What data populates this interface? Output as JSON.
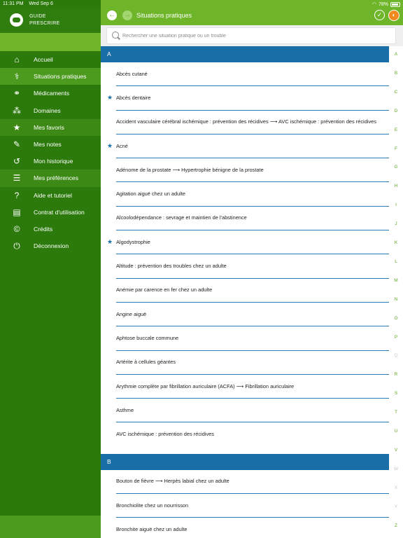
{
  "status": {
    "time": "11:31 PM",
    "date": "Wed Sep 6",
    "battery": "78%"
  },
  "brand": {
    "line1": "GUIDE",
    "line2": "PRESCRIRE"
  },
  "sidebar": {
    "items": [
      {
        "label": "Accueil",
        "icon": "home-icon",
        "glyph": "⌂"
      },
      {
        "label": "Situations pratiques",
        "icon": "situations-icon",
        "glyph": "⚕"
      },
      {
        "label": "Médicaments",
        "icon": "pills-icon",
        "glyph": "⚭"
      },
      {
        "label": "Domaines",
        "icon": "domains-icon",
        "glyph": "⁂"
      },
      {
        "label": "Mes favoris",
        "icon": "star-icon",
        "glyph": "★"
      },
      {
        "label": "Mes notes",
        "icon": "pencil-icon",
        "glyph": "✎"
      },
      {
        "label": "Mon historique",
        "icon": "history-icon",
        "glyph": "↺"
      },
      {
        "label": "Mes préférences",
        "icon": "sliders-icon",
        "glyph": "☰"
      },
      {
        "label": "Aide et tutoriel",
        "icon": "help-icon",
        "glyph": "?"
      },
      {
        "label": "Contrat d'utilisation",
        "icon": "document-icon",
        "glyph": "▤"
      },
      {
        "label": "Crédits",
        "icon": "credits-icon",
        "glyph": "©"
      },
      {
        "label": "Déconnexion",
        "icon": "power-icon",
        "glyph": "⏻"
      }
    ]
  },
  "header": {
    "title": "Situations pratiques"
  },
  "search": {
    "placeholder": "Rechercher une situation pratique ou un trouble"
  },
  "sections": [
    {
      "letter": "A",
      "rows": [
        {
          "label": "Abcès cutané",
          "starred": false
        },
        {
          "label": "Abcès dentaire",
          "starred": true
        },
        {
          "label": "Accident vasculaire cérébral ischémique : prévention des récidives ⟶ AVC ischémique : prévention des récidives",
          "starred": false
        },
        {
          "label": "Acné",
          "starred": true
        },
        {
          "label": "Adénome de la prostate ⟶ Hypertrophie bénigne de la prostate",
          "starred": false
        },
        {
          "label": "Agitation aiguë chez un adulte",
          "starred": false
        },
        {
          "label": "Alcoolodépendance : sevrage et maintien de l'abstinence",
          "starred": false
        },
        {
          "label": "Algodystrophie",
          "starred": true
        },
        {
          "label": "Altitude : prévention des troubles chez un adulte",
          "starred": false
        },
        {
          "label": "Anémie par carence en fer chez un adulte",
          "starred": false
        },
        {
          "label": "Angine aiguë",
          "starred": false
        },
        {
          "label": "Aphtose buccale commune",
          "starred": false
        },
        {
          "label": "Artérite à cellules géantes",
          "starred": false
        },
        {
          "label": "Arythmie complète par fibrillation auriculaire (ACFA) ⟶ Fibrillation auriculaire",
          "starred": false
        },
        {
          "label": "Asthme",
          "starred": false
        },
        {
          "label": "AVC ischémique : prévention des récidives",
          "starred": false
        }
      ]
    },
    {
      "letter": "B",
      "rows": [
        {
          "label": "Bouton de fièvre ⟶ Herpès labial chez un adulte",
          "starred": false
        },
        {
          "label": "Bronchiolite chez un nourrisson",
          "starred": false
        },
        {
          "label": "Bronchite aiguë chez un adulte",
          "starred": false
        }
      ]
    }
  ],
  "alphabet": [
    {
      "l": "A",
      "on": true
    },
    {
      "l": "B",
      "on": true
    },
    {
      "l": "C",
      "on": true
    },
    {
      "l": "D",
      "on": true
    },
    {
      "l": "E",
      "on": true
    },
    {
      "l": "F",
      "on": true
    },
    {
      "l": "G",
      "on": true
    },
    {
      "l": "H",
      "on": true
    },
    {
      "l": "I",
      "on": true
    },
    {
      "l": "J",
      "on": true
    },
    {
      "l": "K",
      "on": true
    },
    {
      "l": "L",
      "on": true
    },
    {
      "l": "M",
      "on": true
    },
    {
      "l": "N",
      "on": true
    },
    {
      "l": "O",
      "on": true
    },
    {
      "l": "P",
      "on": true
    },
    {
      "l": "Q",
      "on": false
    },
    {
      "l": "R",
      "on": true
    },
    {
      "l": "S",
      "on": true
    },
    {
      "l": "T",
      "on": true
    },
    {
      "l": "U",
      "on": true
    },
    {
      "l": "V",
      "on": true
    },
    {
      "l": "W",
      "on": false
    },
    {
      "l": "X",
      "on": false
    },
    {
      "l": "Y",
      "on": false
    },
    {
      "l": "Z",
      "on": true
    }
  ],
  "colors": {
    "sidebar_dark": "#2b7a0b",
    "sidebar_light": "#6fb52a",
    "accent_blue": "#1a6ea8",
    "index_green": "#5fa822"
  }
}
